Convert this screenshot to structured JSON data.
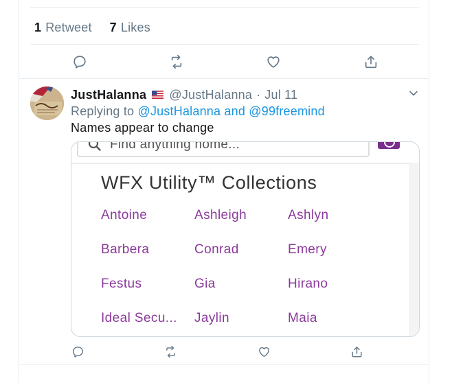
{
  "stats": {
    "retweets_count": "1",
    "retweets_label": "Retweet",
    "likes_count": "7",
    "likes_label": "Likes"
  },
  "actions_icons": [
    "reply-icon",
    "retweet-icon",
    "like-icon",
    "share-icon"
  ],
  "tweet": {
    "display_name": "JustHalanna",
    "handle": "@JustHalanna",
    "separator": "·",
    "date": "Jul 11",
    "replying_prefix": "Replying to",
    "reply_to_1": "@JustHalanna",
    "reply_conjunction": "and",
    "reply_to_2": "@99freemind",
    "text": "Names appear to change"
  },
  "media": {
    "search_placeholder": "Find anything home...",
    "collection_title": "WFX Utility™ Collections",
    "names": [
      [
        "Antoine",
        "Ashleigh",
        "Ashlyn"
      ],
      [
        "Barbera",
        "Conrad",
        "Emery"
      ],
      [
        "Festus",
        "Gia",
        "Hirano"
      ],
      [
        "Ideal Secu...",
        "Jaylin",
        "Maia"
      ]
    ]
  },
  "colors": {
    "accent_link": "#1b95e0",
    "muted_text": "#657786",
    "collection_name": "#8b3a9b",
    "brand_button": "#7b2d8b"
  }
}
